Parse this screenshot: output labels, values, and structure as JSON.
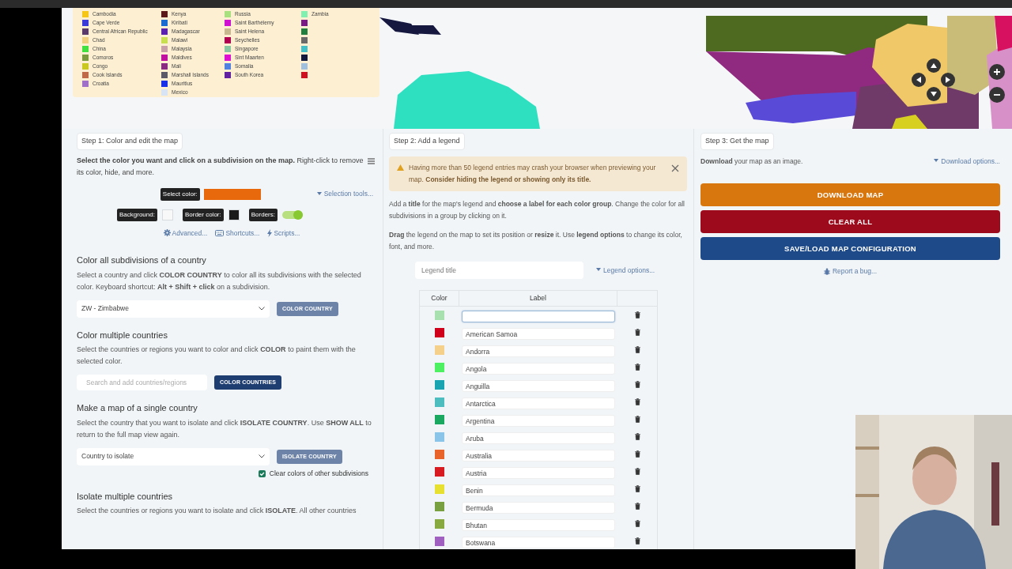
{
  "map_legend": {
    "columns": [
      {
        "items": [
          {
            "label": "Cambodia",
            "color": "#f5c518"
          },
          {
            "label": "Cape Verde",
            "color": "#3a3ad8"
          },
          {
            "label": "Central African Republic",
            "color": "#5a3a6a"
          },
          {
            "label": "Chad",
            "color": "#f0d080"
          },
          {
            "label": "China",
            "color": "#40e040"
          },
          {
            "label": "Comoros",
            "color": "#7a9a40"
          },
          {
            "label": "Congo",
            "color": "#c8c820"
          },
          {
            "label": "Cook Islands",
            "color": "#c06a4a"
          },
          {
            "label": "Croatia",
            "color": "#a070c8"
          }
        ]
      },
      {
        "items": [
          {
            "label": "Kenya",
            "color": "#5a1818"
          },
          {
            "label": "Kiribati",
            "color": "#1a6ad0"
          },
          {
            "label": "Madagascar",
            "color": "#5a20b0"
          },
          {
            "label": "Malawi",
            "color": "#c8e050"
          },
          {
            "label": "Malaysia",
            "color": "#c8a0a8"
          },
          {
            "label": "Maldives",
            "color": "#c010a0"
          },
          {
            "label": "Mali",
            "color": "#8a2a80"
          },
          {
            "label": "Marshall Islands",
            "color": "#5a5a68"
          },
          {
            "label": "Mauritius",
            "color": "#1a30e8"
          },
          {
            "label": "Mexico",
            "color": "#d8e4f4"
          }
        ]
      },
      {
        "items": [
          {
            "label": "Russia",
            "color": "#a8e080"
          },
          {
            "label": "Saint Barthélemy",
            "color": "#d010d0"
          },
          {
            "label": "Saint Helena",
            "color": "#c8b890"
          },
          {
            "label": "Seychelles",
            "color": "#b00050"
          },
          {
            "label": "Singapore",
            "color": "#88c8a0"
          },
          {
            "label": "Sint Maarten",
            "color": "#e010d0"
          },
          {
            "label": "Somalia",
            "color": "#5080e0"
          },
          {
            "label": "South Korea",
            "color": "#6020a0"
          }
        ]
      },
      {
        "items": [
          {
            "label": "Zambia",
            "color": "#80f0b0"
          },
          {
            "color": "#7a1a88"
          },
          {
            "color": "#208040"
          },
          {
            "color": "#6a6a6a"
          },
          {
            "color": "#40c0c8"
          },
          {
            "color": "#101840"
          },
          {
            "color": "#a0c0e0"
          },
          {
            "color": "#d01020"
          }
        ]
      }
    ]
  },
  "step1": {
    "tab": "Step 1: Color and edit the map",
    "intro": "**Select the color you want and click on a subdivision on the map.** Right-click to remove its color, hide, and more.",
    "pickers": [
      {
        "label": "Select color:",
        "color": "#e8680c"
      }
    ],
    "selection_tools": "Selection tools...",
    "settings": [
      {
        "kind": "swatch",
        "label": "Background:",
        "color": "#f8f8f8"
      },
      {
        "kind": "swatch",
        "label": "Border color:",
        "color": "#1a1a1a"
      },
      {
        "kind": "toggle",
        "label": "Borders:",
        "on": true
      }
    ],
    "links": [
      {
        "kind": "gear",
        "label": "Advanced..."
      },
      {
        "kind": "keyboard",
        "label": "Shortcuts..."
      },
      {
        "kind": "bolt",
        "label": "Scripts..."
      }
    ],
    "sections": [
      {
        "kind": "select",
        "heading": "Color all subdivisions of a country",
        "text": "Select a country and click **COLOR COUNTRY** to color all its subdivisions with the selected color. Keyboard shortcut: **Alt + Shift + click** on a subdivision.",
        "value": "ZW - Zimbabwe",
        "button": {
          "label": "COLOR COUNTRY"
        }
      },
      {
        "kind": "search",
        "heading": "Color multiple countries",
        "text": "Select the countries or regions you want to color and click **COLOR** to paint them with the selected color.",
        "placeholder": "Search and add countries/regions",
        "button": {
          "label": "COLOR COUNTRIES"
        }
      },
      {
        "kind": "select",
        "heading": "Make a map of a single country",
        "text": "Select the country that you want to isolate and click **ISOLATE COUNTRY**. Use **SHOW ALL** to return to the full map view again.",
        "value": "Country to isolate",
        "button": {
          "label": "ISOLATE COUNTRY"
        },
        "checkbox": {
          "label": "Clear colors of other subdivisions",
          "checked": true
        }
      },
      {
        "kind": "text",
        "heading": "Isolate multiple countries",
        "text": "Select the countries or regions you want to isolate and click **ISOLATE**. All other countries"
      }
    ]
  },
  "step2": {
    "tab": "Step 2: Add a legend",
    "alert": "Having more than 50 legend entries may crash your browser when previewing your map. **Consider hiding the legend or showing only its title.**",
    "paragraphs": [
      "Add a **title** for the map's legend and **choose a label for each color group**. Change the color for all subdivisions in a group by clicking on it.",
      "**Drag** the legend on the map to set its position or **resize** it. Use **legend options** to change its color, font, and more."
    ],
    "title_placeholder": "Legend title",
    "options_link": "Legend options...",
    "columns": [
      "Color",
      "Label"
    ],
    "rows": [
      {
        "color": "#a8e0b0",
        "focused": true
      },
      {
        "color": "#d0021b",
        "label": "American Samoa",
        "focused": false
      },
      {
        "color": "#f5d08a",
        "label": "Andorra",
        "focused": false
      },
      {
        "color": "#4cf060",
        "label": "Angola",
        "focused": false
      },
      {
        "color": "#1aa3b0",
        "label": "Anguilla",
        "focused": false
      },
      {
        "color": "#4dbdc0",
        "label": "Antarctica",
        "focused": false
      },
      {
        "color": "#1aa860",
        "label": "Argentina",
        "focused": false
      },
      {
        "color": "#8ac4e8",
        "label": "Aruba",
        "focused": false
      },
      {
        "color": "#e8642a",
        "label": "Australia",
        "focused": false
      },
      {
        "color": "#d81b20",
        "label": "Austria",
        "focused": false
      },
      {
        "color": "#e8e030",
        "label": "Benin",
        "focused": false
      },
      {
        "color": "#78a040",
        "label": "Bermuda",
        "focused": false
      },
      {
        "color": "#88a840",
        "label": "Bhutan",
        "focused": false
      },
      {
        "color": "#a060c0",
        "label": "Botswana",
        "focused": false
      }
    ]
  },
  "step3": {
    "tab": "Step 3: Get the map",
    "text": "**Download** your map as an image.",
    "options_link": "Download options...",
    "buttons": [
      {
        "label": "DOWNLOAD MAP",
        "color": "#d9770f"
      },
      {
        "label": "CLEAR ALL",
        "color": "#9c0a1c"
      },
      {
        "label": "SAVE/LOAD MAP CONFIGURATION",
        "color": "#1e4a8a"
      }
    ],
    "bug_link": "Report a bug..."
  }
}
